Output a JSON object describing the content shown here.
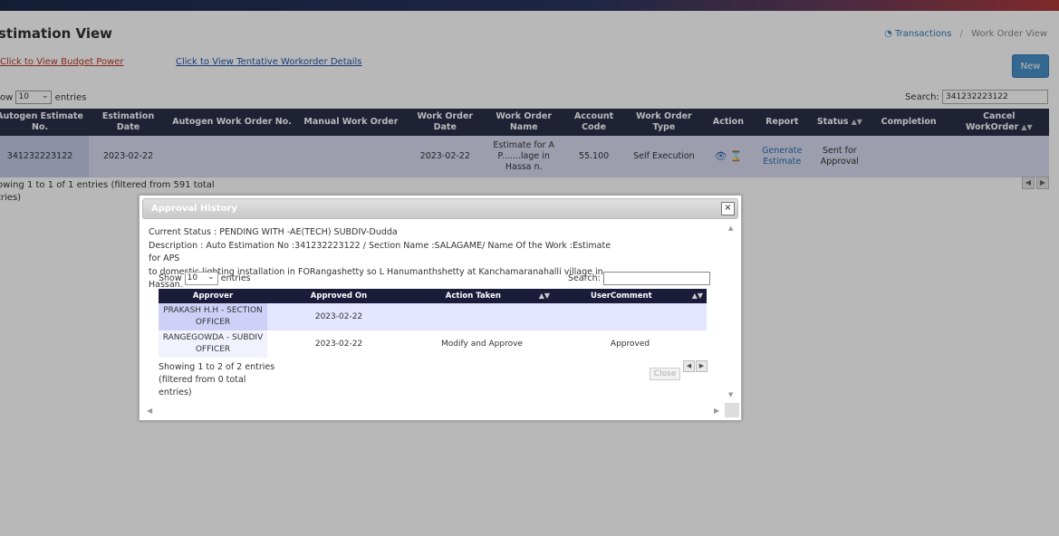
{
  "page": {
    "title": "stimation View",
    "breadcrumb": {
      "transactions": "Transactions",
      "separator": "/",
      "current": "Work Order View"
    },
    "links": {
      "budget_power": "Click to View Budget Power",
      "tentative_workorder": "Click to View Tentative Workorder Details"
    },
    "new_button": "New",
    "show_prefix": "ow",
    "show_value": "10",
    "show_suffix": "entries",
    "search_label": "Search:",
    "search_value": "341232223122",
    "table": {
      "headers": [
        "Autogen Estimate No.",
        "Estimation Date",
        "Autogen Work Order No.",
        "Manual Work Order",
        "Work Order Date",
        "Work Order Name",
        "Account Code",
        "Work Order Type",
        "Action",
        "Report",
        "Status",
        "Completion",
        "Cancel WorkOrder"
      ],
      "row": {
        "estimate_no": "341232223122",
        "estimation_date": "2023-02-22",
        "autogen_wo_no": "",
        "manual_wo": "",
        "wo_date": "2023-02-22",
        "wo_name": "Estimate for A P.......lage in Hassa n.",
        "account_code": "55.100",
        "wo_type": "Self Execution",
        "report": "Generate Estimate",
        "status": "Sent for Approval",
        "completion": "",
        "cancel": ""
      }
    },
    "showing_text_line1": "owing 1 to 1 of 1 entries (filtered from 591 total",
    "showing_text_line2": "tries)"
  },
  "dialog": {
    "title": "Approval History",
    "close_icon": "×",
    "status_line": "Current Status : PENDING WITH -AE(TECH) SUBDIV-Dudda",
    "description_line1": "Description : Auto Estimation No :341232223122 / Section Name :SALAGAME/ Name Of the Work :Estimate for APS",
    "description_line2": "to domestic lighting installation in FORangashetty so L Hanumanthshetty at Kanchamaranahalli village in Hassan.",
    "show_label": "Show",
    "show_value": "10",
    "entries_label": "entries",
    "search_label": "Search:",
    "table": {
      "headers": [
        "Approver",
        "Approved On",
        "Action Taken",
        "UserComment"
      ],
      "rows": [
        {
          "approver": "PRAKASH H.H - SECTION OFFICER",
          "approved_on": "2023-02-22",
          "action": "",
          "comment": ""
        },
        {
          "approver": "RANGEGOWDA - SUBDIV OFFICER",
          "approved_on": "2023-02-22",
          "action": "Modify and Approve",
          "comment": "Approved"
        }
      ]
    },
    "showing_text": "Showing 1 to 2 of 2 entries (filtered from 0 total entries)",
    "close_button": "Close"
  },
  "icons": {
    "breadcrumb": "dashboard-icon",
    "view": "eye-icon",
    "history": "hourglass-icon",
    "sort": "sort-both-icon"
  },
  "colors": {
    "header_bg": "#2b2e4a",
    "row_bg": "#d8dcf0",
    "link_red": "#c0392b",
    "link_blue": "#2255aa",
    "new_button": "#4a90c8"
  }
}
